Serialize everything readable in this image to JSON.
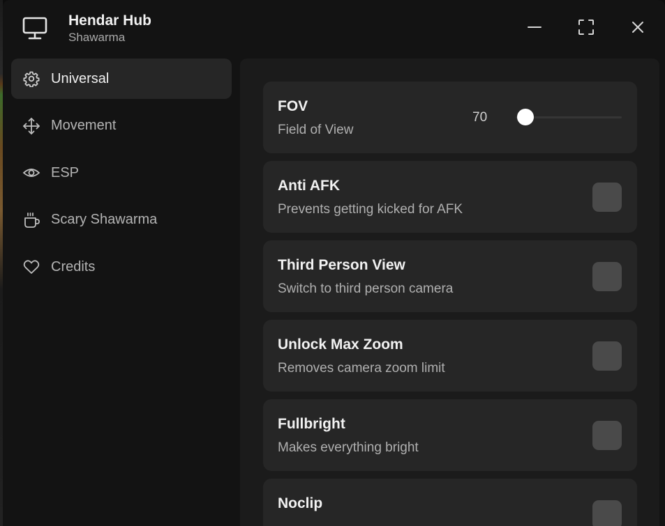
{
  "window": {
    "title": "Hendar Hub",
    "subtitle": "Shawarma",
    "icon": "monitor-icon",
    "controls": [
      "minimize-icon",
      "maximize-icon",
      "close-icon"
    ]
  },
  "sidebar": {
    "items": [
      {
        "label": "Universal",
        "icon": "gear-icon",
        "active": true
      },
      {
        "label": "Movement",
        "icon": "move-arrows-icon",
        "active": false
      },
      {
        "label": "ESP",
        "icon": "eye-icon",
        "active": false
      },
      {
        "label": "Scary Shawarma",
        "icon": "coffee-cup-icon",
        "active": false
      },
      {
        "label": "Credits",
        "icon": "heart-icon",
        "active": false
      }
    ]
  },
  "main": {
    "settings": [
      {
        "title": "FOV",
        "description": "Field of View",
        "type": "slider",
        "value": "70",
        "slider_fraction": 0.0
      },
      {
        "title": "Anti AFK",
        "description": "Prevents getting kicked for AFK",
        "type": "toggle",
        "enabled": false
      },
      {
        "title": "Third Person View",
        "description": "Switch to third person camera",
        "type": "toggle",
        "enabled": false
      },
      {
        "title": "Unlock Max Zoom",
        "description": "Removes camera zoom limit",
        "type": "toggle",
        "enabled": false
      },
      {
        "title": "Fullbright",
        "description": "Makes everything bright",
        "type": "toggle",
        "enabled": false
      },
      {
        "title": "Noclip",
        "description": "",
        "type": "toggle",
        "enabled": false
      }
    ]
  },
  "colors": {
    "window_bg": "#131313",
    "panel_bg": "#1b1b1b",
    "card_bg": "#262626",
    "toggle_off": "#4a4a4a",
    "text_primary": "#f2f2f2",
    "text_secondary": "#b0b0b0"
  }
}
